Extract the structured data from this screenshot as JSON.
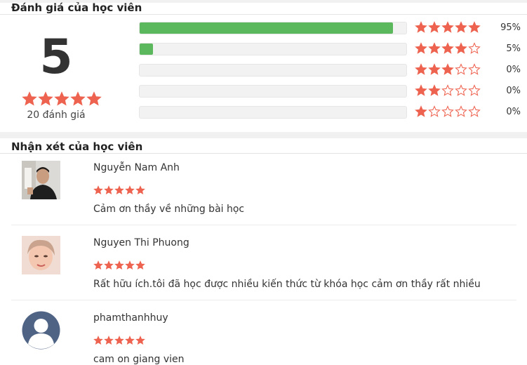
{
  "ratings_section": {
    "title": "Đánh giá của học viên",
    "average": "5",
    "average_stars": 5,
    "count_label": "20 đánh giá",
    "breakdown": [
      {
        "stars": 5,
        "percent_label": "95%",
        "fraction": 0.95
      },
      {
        "stars": 4,
        "percent_label": "5%",
        "fraction": 0.05
      },
      {
        "stars": 3,
        "percent_label": "0%",
        "fraction": 0
      },
      {
        "stars": 2,
        "percent_label": "0%",
        "fraction": 0
      },
      {
        "stars": 1,
        "percent_label": "0%",
        "fraction": 0
      }
    ]
  },
  "reviews_section": {
    "title": "Nhận xét của học viên",
    "reviews": [
      {
        "name": "Nguyễn Nam Anh",
        "stars": 5,
        "text": "Cảm ơn thầy về những bài học",
        "avatar": "photo-man"
      },
      {
        "name": "Nguyen Thi Phuong",
        "stars": 5,
        "text": "Rất hữu ích.tôi đã học được nhiều kiến thức từ khóa học cảm ơn thầy rất nhiều",
        "avatar": "photo-woman"
      },
      {
        "name": "phamthanhhuy",
        "stars": 5,
        "text": "cam on giang vien",
        "avatar": "default-user-icon"
      }
    ]
  },
  "colors": {
    "star": "#ee6350",
    "bar_fill": "#5cb85c",
    "bar_track": "#f2f2f2"
  }
}
